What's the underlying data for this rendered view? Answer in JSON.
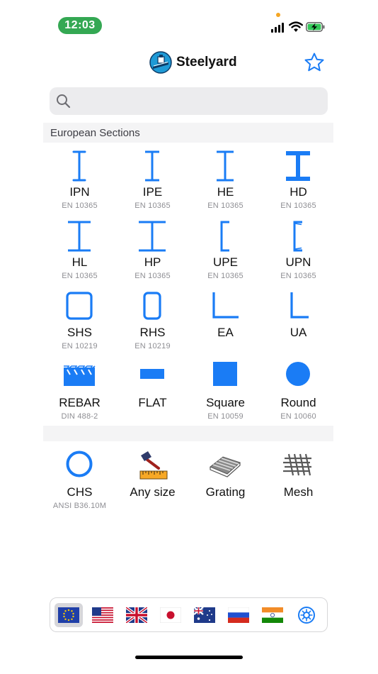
{
  "status": {
    "time": "12:03"
  },
  "header": {
    "title": "Steelyard"
  },
  "search": {
    "placeholder": ""
  },
  "section": {
    "title": "European Sections"
  },
  "sections": [
    {
      "label": "IPN",
      "std": "EN 10365",
      "icon": "i-beam-narrow-icon"
    },
    {
      "label": "IPE",
      "std": "EN 10365",
      "icon": "i-beam-icon"
    },
    {
      "label": "HE",
      "std": "EN 10365",
      "icon": "h-beam-icon"
    },
    {
      "label": "HD",
      "std": "EN 10365",
      "icon": "heavy-h-beam-icon"
    },
    {
      "label": "HL",
      "std": "EN 10365",
      "icon": "wide-h-beam-icon"
    },
    {
      "label": "HP",
      "std": "EN 10365",
      "icon": "bearing-pile-icon"
    },
    {
      "label": "UPE",
      "std": "EN 10365",
      "icon": "channel-icon"
    },
    {
      "label": "UPN",
      "std": "EN 10365",
      "icon": "tapered-channel-icon"
    },
    {
      "label": "SHS",
      "std": "EN 10219",
      "icon": "square-hollow-icon"
    },
    {
      "label": "RHS",
      "std": "EN 10219",
      "icon": "rect-hollow-icon"
    },
    {
      "label": "EA",
      "std": "",
      "icon": "equal-angle-icon"
    },
    {
      "label": "UA",
      "std": "",
      "icon": "unequal-angle-icon"
    },
    {
      "label": "REBAR",
      "std": "DIN 488-2",
      "icon": "rebar-icon"
    },
    {
      "label": "FLAT",
      "std": "",
      "icon": "flat-bar-icon"
    },
    {
      "label": "Square",
      "std": "EN 10059",
      "icon": "square-bar-icon"
    },
    {
      "label": "Round",
      "std": "EN 10060",
      "icon": "round-bar-icon"
    }
  ],
  "extras": [
    {
      "label": "CHS",
      "std": "ANSI B36.10M",
      "icon": "circular-hollow-icon"
    },
    {
      "label": "Any size",
      "std": "",
      "icon": "hammer-ruler-icon"
    },
    {
      "label": "Grating",
      "std": "",
      "icon": "grating-icon"
    },
    {
      "label": "Mesh",
      "std": "",
      "icon": "mesh-icon"
    }
  ],
  "tabs": [
    {
      "icon": "eu-flag-icon",
      "active": true
    },
    {
      "icon": "us-flag-icon",
      "active": false
    },
    {
      "icon": "uk-flag-icon",
      "active": false
    },
    {
      "icon": "japan-flag-icon",
      "active": false
    },
    {
      "icon": "australia-flag-icon",
      "active": false
    },
    {
      "icon": "russia-flag-icon",
      "active": false
    },
    {
      "icon": "india-flag-icon",
      "active": false
    },
    {
      "icon": "settings-gear-icon",
      "active": false
    }
  ],
  "colors": {
    "accent": "#1a7cf5",
    "statusGreen": "#34a853"
  }
}
